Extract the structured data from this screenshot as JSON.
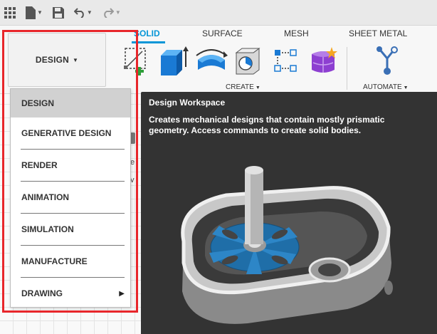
{
  "qat": {
    "icons": [
      "apps-grid-icon",
      "file-icon",
      "save-icon",
      "undo-icon",
      "redo-icon"
    ]
  },
  "ribbon": {
    "workspace_button": "DESIGN",
    "tabs": [
      "SOLID",
      "SURFACE",
      "MESH",
      "SHEET METAL"
    ],
    "active_tab": "SOLID",
    "groups": {
      "create": "CREATE",
      "automate": "AUTOMATE"
    },
    "tool_icons": [
      "create-sketch-icon",
      "extrude-icon",
      "revolve-icon",
      "hole-icon",
      "pattern-icon",
      "form-icon",
      "automate-icon"
    ]
  },
  "canvas": {
    "frag_e": "e",
    "frag_v": "v"
  },
  "dropdown": {
    "items": [
      {
        "label": "DESIGN",
        "selected": true
      },
      {
        "label": "GENERATIVE DESIGN"
      },
      {
        "label": "RENDER"
      },
      {
        "label": "ANIMATION"
      },
      {
        "label": "SIMULATION"
      },
      {
        "label": "MANUFACTURE"
      },
      {
        "label": "DRAWING",
        "submenu": true
      }
    ]
  },
  "tooltip": {
    "title": "Design Workspace",
    "description": "Creates mechanical designs that contain mostly prismatic geometry. Access commands to create solid bodies.",
    "image": "gearbox-model-image"
  },
  "colors": {
    "accent": "#0696d7",
    "highlight": "#e8262b",
    "tooltip_bg": "#333333"
  }
}
